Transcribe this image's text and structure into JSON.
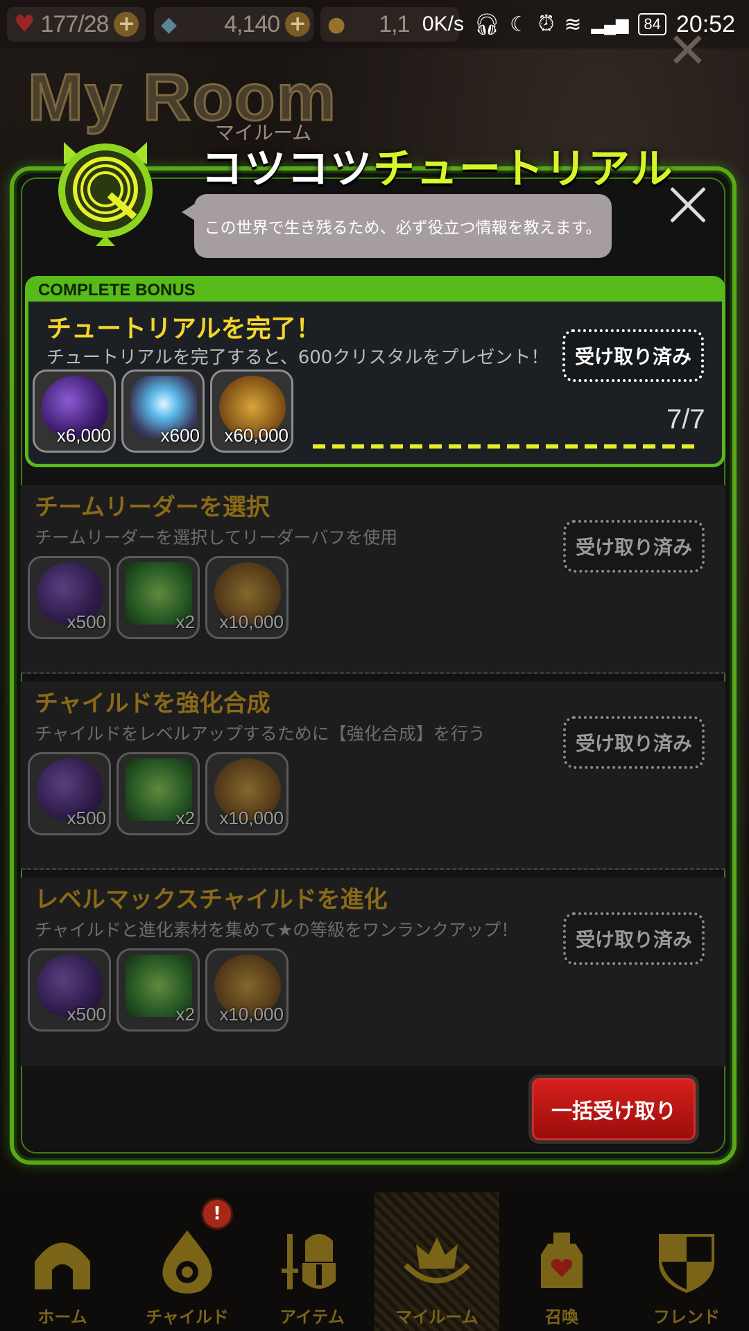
{
  "status_bar": {
    "hp": "177/28",
    "crystals": "4,140",
    "coins": "1,1",
    "net_speed": "0K/s",
    "battery": "84",
    "time": "20:52"
  },
  "background": {
    "title": "My Room",
    "subtitle": "マイルーム"
  },
  "modal": {
    "title_white": "コツコツ",
    "title_green": "チュートリアル",
    "speech": "この世界で生き残るため、必ず役立つ情報を教えます。",
    "complete_bonus": {
      "header": "COMPLETE BONUS",
      "title": "チュートリアルを完了！",
      "description": "チュートリアルを完了すると、600クリスタルをプレゼント！",
      "status": "受け取り済み",
      "progress": "7/7",
      "progress_fraction": 1.0,
      "rewards": [
        {
          "type": "gem",
          "qty": "x6,000"
        },
        {
          "type": "crystal",
          "qty": "x600"
        },
        {
          "type": "coin",
          "qty": "x60,000"
        }
      ]
    },
    "missions": [
      {
        "title": "チームリーダーを選択",
        "description": "チームリーダーを選択してリーダーバフを使用",
        "status": "受け取り済み",
        "rewards": [
          {
            "type": "gem",
            "qty": "x500"
          },
          {
            "type": "ticket",
            "qty": "x2"
          },
          {
            "type": "coin",
            "qty": "x10,000"
          }
        ]
      },
      {
        "title": "チャイルドを強化合成",
        "description": "チャイルドをレベルアップするために【強化合成】を行う",
        "status": "受け取り済み",
        "rewards": [
          {
            "type": "gem",
            "qty": "x500"
          },
          {
            "type": "ticket",
            "qty": "x2"
          },
          {
            "type": "coin",
            "qty": "x10,000"
          }
        ]
      },
      {
        "title": "レベルマックスチャイルドを進化",
        "description": "チャイルドと進化素材を集めて★の等級をワンランクアップ！",
        "status": "受け取り済み",
        "rewards": [
          {
            "type": "gem",
            "qty": "x500"
          },
          {
            "type": "ticket",
            "qty": "x2"
          },
          {
            "type": "coin",
            "qty": "x10,000"
          }
        ]
      }
    ],
    "batch_button": "一括受け取り"
  },
  "nav": {
    "items": [
      {
        "label": "ホーム",
        "icon": "home-icon"
      },
      {
        "label": "チャイルド",
        "icon": "child-flame-icon"
      },
      {
        "label": "アイテム",
        "icon": "item-knight-icon"
      },
      {
        "label": "マイルーム",
        "icon": "myroom-crown-icon"
      },
      {
        "label": "召喚",
        "icon": "summon-bottle-icon"
      },
      {
        "label": "フレンド",
        "icon": "friend-shield-icon"
      }
    ],
    "notification_badge": "!"
  },
  "colors": {
    "accent_green": "#58b91a",
    "title_yellow": "#d9f52a",
    "button_red": "#d8201c",
    "nav_gold": "#7a6418"
  }
}
